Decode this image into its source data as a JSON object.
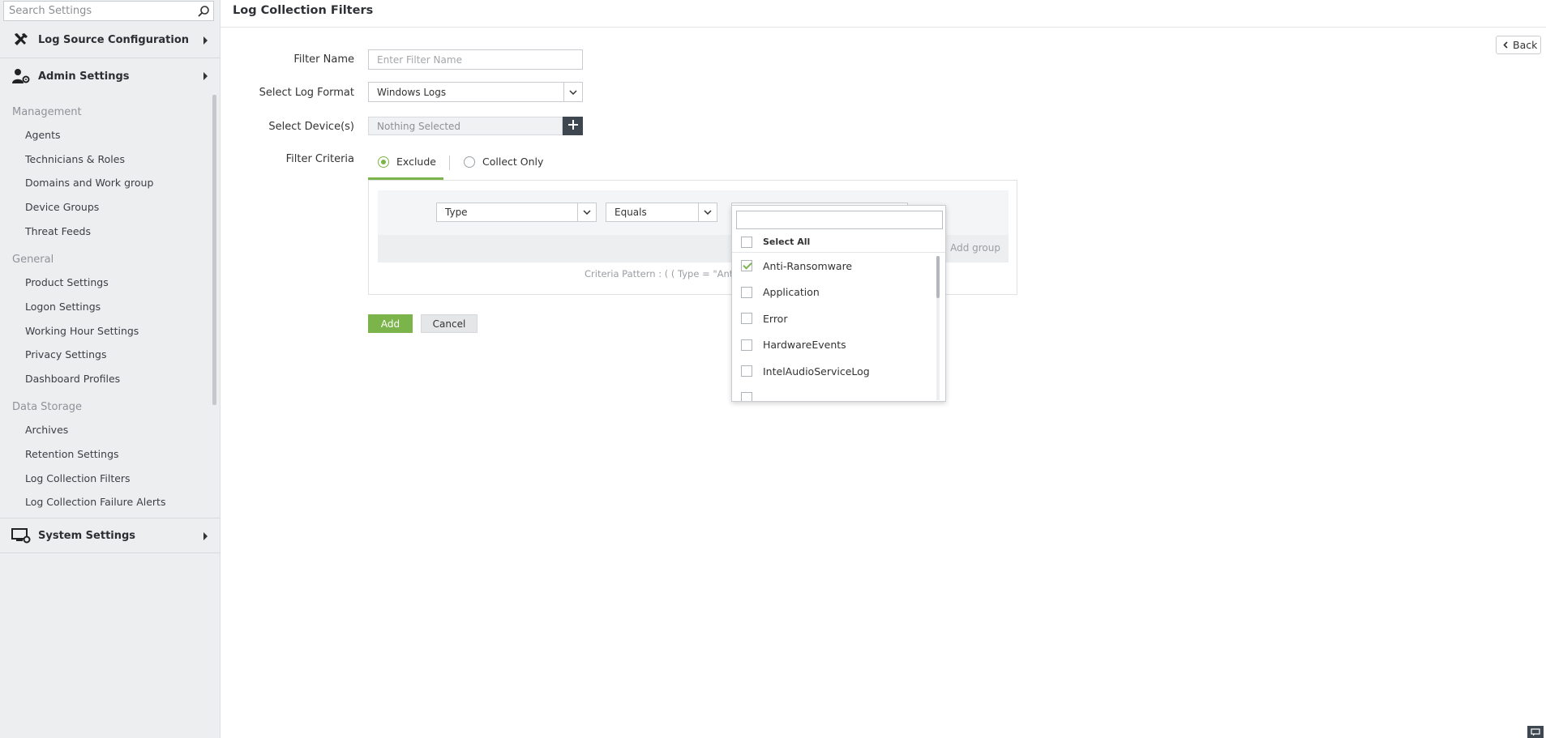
{
  "sidebar": {
    "search_placeholder": "Search Settings",
    "sections": {
      "log_source": "Log Source Configuration",
      "admin": "Admin Settings",
      "system": "System Settings"
    },
    "groups": {
      "management": "Management",
      "general": "General",
      "data_storage": "Data Storage"
    },
    "management_items": [
      "Agents",
      "Technicians & Roles",
      "Domains and Work group",
      "Device Groups",
      "Threat Feeds"
    ],
    "general_items": [
      "Product Settings",
      "Logon Settings",
      "Working Hour Settings",
      "Privacy Settings",
      "Dashboard Profiles"
    ],
    "data_storage_items": [
      "Archives",
      "Retention Settings",
      "Log Collection Filters",
      "Log Collection Failure Alerts"
    ]
  },
  "page": {
    "title": "Log Collection Filters",
    "back_label": "Back"
  },
  "form": {
    "filter_name_label": "Filter Name",
    "filter_name_placeholder": "Enter Filter Name",
    "log_format_label": "Select Log Format",
    "log_format_value": "Windows Logs",
    "devices_label": "Select Device(s)",
    "devices_value": "Nothing Selected",
    "criteria_label": "Filter Criteria",
    "tabs": {
      "exclude": "Exclude",
      "collect_only": "Collect Only"
    },
    "selected_tab": "exclude",
    "criteria_field": "Type",
    "criteria_operator": "Equals",
    "add_group_label": "Add group",
    "criteria_pattern": "Criteria Pattern : ( ( Type = \"Anti-",
    "add_button": "Add",
    "cancel_button": "Cancel"
  },
  "dropdown": {
    "select_all_label": "Select All",
    "options": [
      {
        "label": "Anti-Ransomware",
        "checked": true
      },
      {
        "label": "Application",
        "checked": false
      },
      {
        "label": "Error",
        "checked": false
      },
      {
        "label": "HardwareEvents",
        "checked": false
      },
      {
        "label": "IntelAudioServiceLog",
        "checked": false
      },
      {
        "label": "",
        "checked": false
      }
    ]
  },
  "colors": {
    "accent": "#7bb44a",
    "dark_button": "#3e4750",
    "sidebar_bg": "#eceef0"
  },
  "icons": {
    "search": "search-icon",
    "log_source": "tools-icon",
    "admin": "user-gear-icon",
    "system": "monitor-gear-icon",
    "back": "chevron-left-icon",
    "chevron": "chevron-down-icon",
    "add": "plus-icon",
    "chat": "chat-icon"
  }
}
